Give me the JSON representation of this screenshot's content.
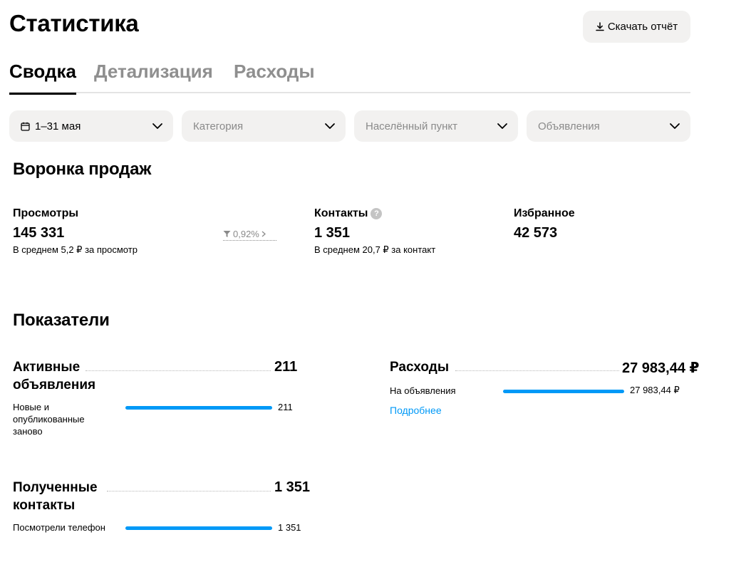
{
  "header": {
    "title": "Статистика",
    "download_label": "Скачать отчёт"
  },
  "tabs": [
    {
      "label": "Сводка",
      "active": true
    },
    {
      "label": "Детализация",
      "active": false
    },
    {
      "label": "Расходы",
      "active": false
    }
  ],
  "filters": {
    "date": {
      "value": "1–31 мая"
    },
    "category": {
      "placeholder": "Категория"
    },
    "location": {
      "placeholder": "Населённый пункт"
    },
    "listings": {
      "placeholder": "Объявления"
    }
  },
  "funnel": {
    "title": "Воронка продаж",
    "views": {
      "label": "Просмотры",
      "value": "145 331",
      "sub": "В среднем 5,2 ₽ за просмотр"
    },
    "conversion": {
      "value": "0,92%"
    },
    "contacts": {
      "label": "Контакты",
      "value": "1 351",
      "sub": "В среднем 20,7 ₽ за контакт"
    },
    "favorites": {
      "label": "Избранное",
      "value": "42 573"
    }
  },
  "metrics": {
    "title": "Показатели",
    "active_listings": {
      "title_line1": "Активные",
      "title_line2": "объявления",
      "value": "211",
      "rows": [
        {
          "label": "Новые и опубликованные заново",
          "value": "211",
          "fraction": 1.0
        }
      ]
    },
    "contacts_received": {
      "title_line1": "Полученные",
      "title_line2": "контакты",
      "value": "1 351",
      "rows": [
        {
          "label": "Посмотрели телефон",
          "value": "1 351",
          "fraction": 1.0
        }
      ]
    },
    "expenses": {
      "title": "Расходы",
      "value": "27 983,44 ₽",
      "rows": [
        {
          "label": "На объявления",
          "value": "27 983,44 ₽",
          "fraction": 1.0
        }
      ],
      "link_label": "Подробнее"
    }
  },
  "colors": {
    "accent": "#0099f7",
    "chip_bg": "#f2f1f0",
    "muted_text": "#8f8f8f"
  },
  "icons": {
    "download": "download-icon",
    "calendar": "calendar-icon",
    "chevron": "chevron-down-icon",
    "funnel": "funnel-icon",
    "help": "help-icon"
  }
}
